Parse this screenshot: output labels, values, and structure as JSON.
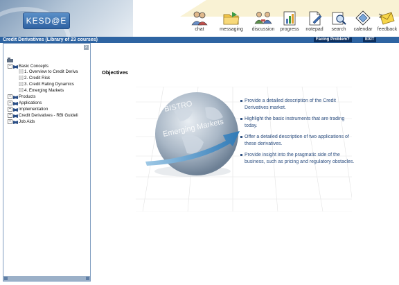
{
  "logo": {
    "text": "KESD@E"
  },
  "toolbar": {
    "items": [
      {
        "id": "chat",
        "label": "chat",
        "icon": "people-chat-icon"
      },
      {
        "id": "messaging",
        "label": "messaging",
        "icon": "folder-icon"
      },
      {
        "id": "discussion",
        "label": "discussion",
        "icon": "discussion-icon"
      },
      {
        "id": "progress",
        "label": "progress",
        "icon": "progress-icon"
      },
      {
        "id": "notepad",
        "label": "notepad",
        "icon": "notepad-icon"
      },
      {
        "id": "search",
        "label": "search",
        "icon": "search-icon"
      },
      {
        "id": "calendar",
        "label": "calendar",
        "icon": "calendar-icon"
      },
      {
        "id": "feedback",
        "label": "feedback",
        "icon": "feedback-icon"
      }
    ]
  },
  "titlebar": {
    "course_title": "Credit Derivatives (Library of 23 courses)",
    "facing_problem_label": "Facing Problem?",
    "exit_label": "EXIT"
  },
  "tree": {
    "close_label": "x",
    "items": [
      {
        "label": "Basic Concepts",
        "toggle": "−",
        "level": 0
      },
      {
        "label": "1. Overview to Credit Deriva",
        "level": 1
      },
      {
        "label": "2. Credit Risk",
        "level": 1
      },
      {
        "label": "3. Credit Rating Dynamics",
        "level": 1
      },
      {
        "label": "4. Emerging Markets",
        "level": 1
      },
      {
        "label": "Products",
        "toggle": "+",
        "level": 0
      },
      {
        "label": "Applications",
        "toggle": "+",
        "level": 0
      },
      {
        "label": "Implementation",
        "toggle": "+",
        "level": 0
      },
      {
        "label": "Credit Derivatives - RBI Guideli",
        "toggle": "+",
        "level": 0
      },
      {
        "label": "Job Aids",
        "toggle": "+",
        "level": 0
      }
    ]
  },
  "content": {
    "heading": "Objectives",
    "globe_text_1": "BISTRO",
    "globe_text_2": "Emerging Markets",
    "bullets": [
      "Provide a detailed description of the Credit Derivatives market.",
      "Highlight the basic instruments that are trading today.",
      "Offer a  detailed description of two applications of these derivatives.",
      "Provide insight into the pragmatic side of the business, such as pricing and regulatory obstacles."
    ]
  },
  "colors": {
    "title_bar": "#2e64a2",
    "bullet_text": "#2d4f80",
    "panel_border": "#7d9bbf"
  }
}
